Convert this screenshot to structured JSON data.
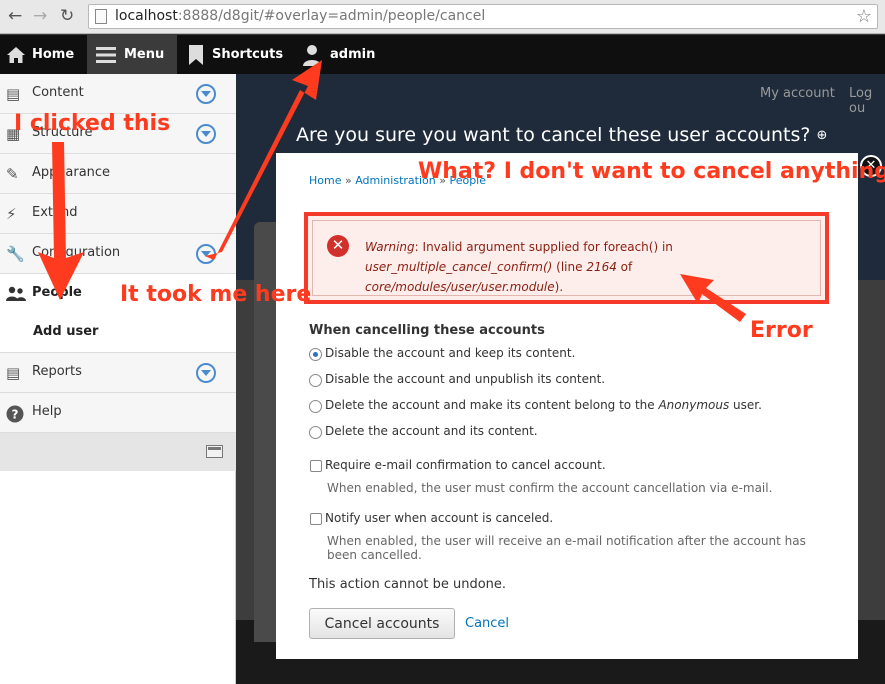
{
  "browser": {
    "url_host": "localhost",
    "url_path": ":8888/d8git/#overlay=admin/people/cancel"
  },
  "toolbar": {
    "home": "Home",
    "menu": "Menu",
    "shortcuts": "Shortcuts",
    "user": "admin"
  },
  "secondary_nav": {
    "my_account": "My account",
    "logout": "Log ou"
  },
  "sidebar": {
    "items": [
      {
        "label": "Content"
      },
      {
        "label": "Structure"
      },
      {
        "label": "Appearance"
      },
      {
        "label": "Extend"
      },
      {
        "label": "Configuration"
      },
      {
        "label": "People"
      },
      {
        "label": "Add user"
      },
      {
        "label": "Reports"
      },
      {
        "label": "Help"
      }
    ]
  },
  "overlay": {
    "title": "Are you sure you want to cancel these user accounts?",
    "breadcrumb": [
      "Home",
      "Administration",
      "People"
    ],
    "breadcrumb_sep": "»"
  },
  "message": {
    "label": "Warning",
    "text": ": Invalid argument supplied for foreach() in",
    "func": "user_multiple_cancel_confirm()",
    "line_pre": " (line ",
    "line": "2164",
    "line_post": " of",
    "file": "core/modules/user/user.module",
    "end": ")."
  },
  "form": {
    "title": "When cancelling these accounts",
    "options": [
      {
        "label": "Disable the account and keep its content.",
        "checked": true
      },
      {
        "label": "Disable the account and unpublish its content.",
        "checked": false
      },
      {
        "label_pre": "Delete the account and make its content belong to the ",
        "label_em": "Anonymous",
        "label_post": " user.",
        "checked": false
      },
      {
        "label": "Delete the account and its content.",
        "checked": false
      }
    ],
    "require_confirm_label": "Require e-mail confirmation to cancel account.",
    "require_confirm_desc": "When enabled, the user must confirm the account cancellation via e-mail.",
    "notify_label": "Notify user when account is canceled.",
    "notify_desc": "When enabled, the user will receive an e-mail notification after the account has been cancelled.",
    "notice": "This action cannot be undone.",
    "submit": "Cancel accounts",
    "cancel_link": "Cancel"
  },
  "annotations": {
    "clicked": "I clicked this",
    "took_me": "It took me here",
    "what": "What? I don't want to cancel anything!",
    "error": "Error"
  },
  "colors": {
    "annotation": "#ff3b1f",
    "link": "#0074bd",
    "toolbar_bg": "#0f0f0f"
  }
}
